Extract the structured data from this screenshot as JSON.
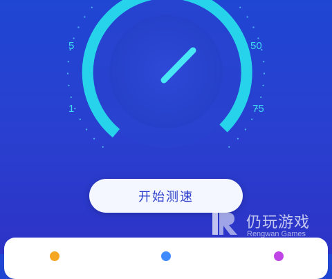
{
  "gauge": {
    "scale_labels": [
      "5",
      "50",
      "1",
      "75"
    ],
    "needle_icon": "speed-needle-icon",
    "colors": {
      "arc": "#2ad6ee",
      "tick": "#4aa8f0",
      "label": "#3fdcf2"
    }
  },
  "actions": {
    "start_label": "开始测速"
  },
  "watermark": {
    "name_cn": "仍玩游戏",
    "name_en": "Rengwan Games"
  },
  "bottom_card": {
    "tab_dots": [
      "#f5a623",
      "#3d8bff",
      "#c045e6"
    ]
  }
}
